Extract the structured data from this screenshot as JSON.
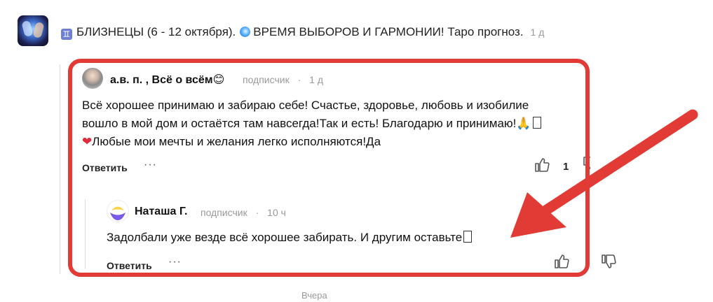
{
  "post": {
    "sign_icon": "gemini-sign-icon",
    "title_before": "БЛИЗНЕЦЫ (6 - 12 октября).",
    "title_after": "ВРЕМЯ ВЫБОРОВ И ГАРМОНИИ! Таро прогноз.",
    "time": "1 д"
  },
  "comments": [
    {
      "author": "а.в. п. , Всё о всём",
      "author_emoji": "😊",
      "role": "подписчик",
      "dot": "·",
      "time": "1 д",
      "text_line1": "Всё хорошее принимаю и забираю себе! Счастье, здоровье, любовь и изобилие",
      "text_line2": "вошло в мой дом и остаётся там навсегда!Так и есть! Благодарю и принимаю!",
      "text_line2_emoji": "🙏",
      "text_line3": "Любые мои мечты и желания легко исполняются!Да",
      "reply_label": "Ответить",
      "more_label": "···",
      "likes": "1"
    },
    {
      "author": "Наташа Г.",
      "role": "подписчик",
      "dot": "·",
      "time": "10 ч",
      "text": "Задолбали уже везде всё хорошее забирать. И другим оставьте",
      "reply_label": "Ответить",
      "more_label": "···"
    }
  ],
  "day_separator": "Вчера",
  "colors": {
    "highlight": "#e23b35",
    "arrow": "#e23b35",
    "meta": "#9a9a9a"
  }
}
